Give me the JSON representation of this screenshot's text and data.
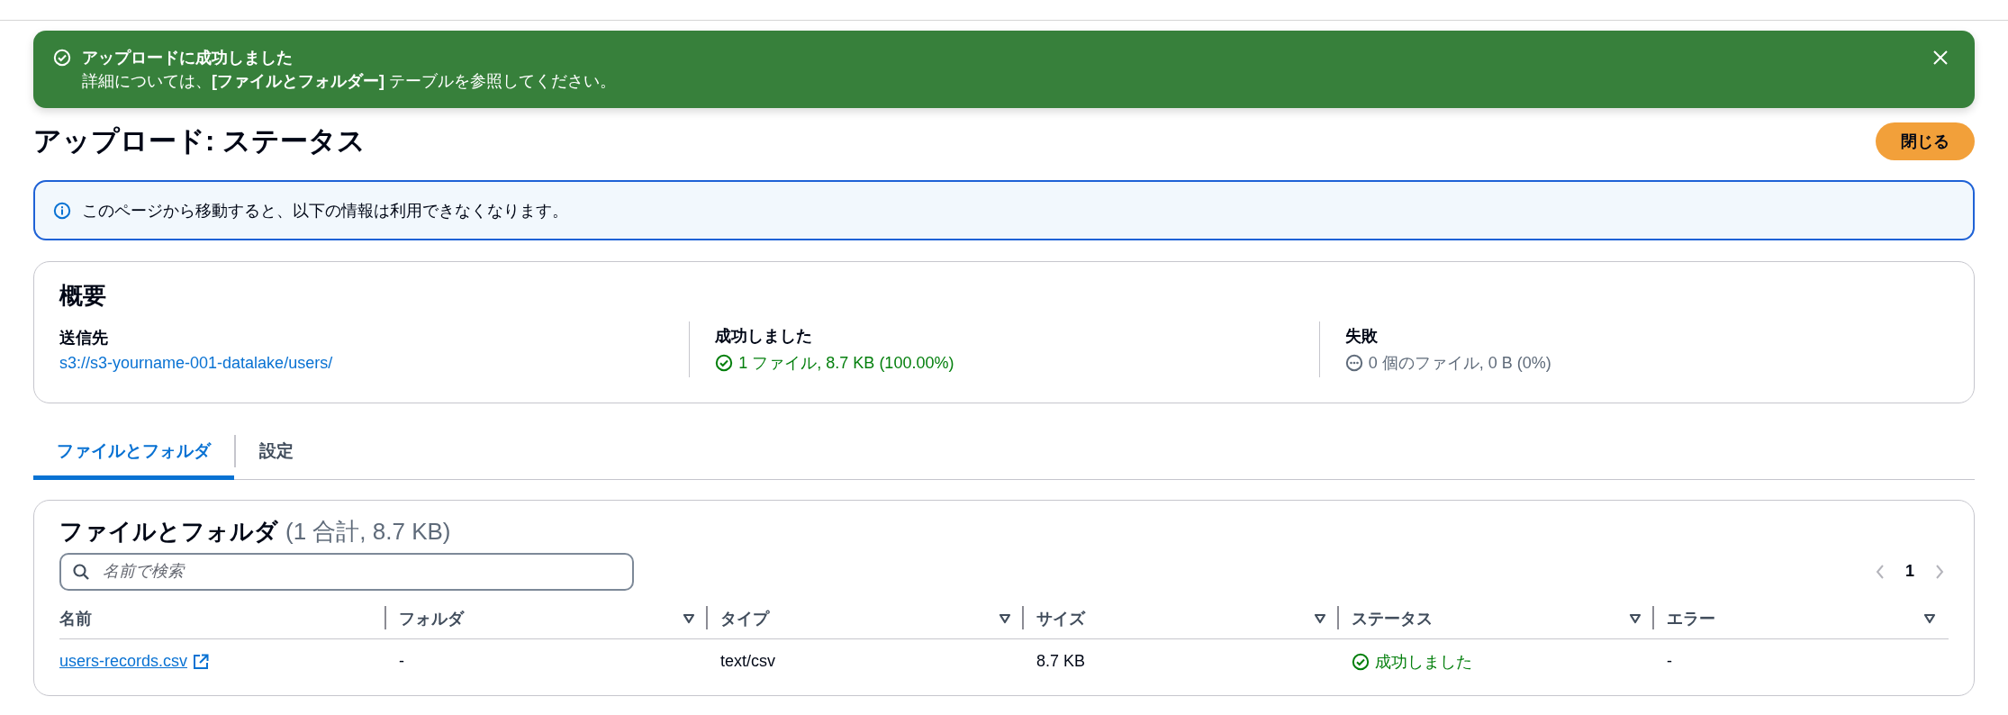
{
  "flash": {
    "title": "アップロードに成功しました",
    "message": "詳細については、**[ファイルとフォルダー]** テーブルを参照してください。",
    "dismissible": true
  },
  "header": {
    "title": "アップロード: ステータス",
    "button": "閉じる"
  },
  "info": {
    "message": "このページから移動すると、以下の情報は利用できなくなります。"
  },
  "summary": {
    "title": "概要",
    "items": [
      {
        "label": "送信先",
        "value": "s3://s3-yourname-001-datalake/users/",
        "kind": "link"
      },
      {
        "label": "成功しました",
        "value": "1 ファイル, 8.7 KB (100.00%)",
        "kind": "success"
      },
      {
        "label": "失敗",
        "value": "0 個のファイル, 0 B (0%)",
        "kind": "pending"
      }
    ]
  },
  "tabs": [
    {
      "label": "ファイルとフォルダ",
      "selected": true
    },
    {
      "label": "設定",
      "selected": false
    }
  ],
  "table": {
    "title": "ファイルとフォルダ",
    "count": "(1 合計, 8.7 KB)",
    "search": {
      "placeholder": "名前で検索"
    },
    "pagination": {
      "prev_disabled": true,
      "next_disabled": true,
      "pages": [
        {
          "label": "1",
          "selected": true
        }
      ]
    },
    "columns": [
      {
        "label": "名前",
        "filterable": false
      },
      {
        "label": "フォルダ",
        "filterable": true
      },
      {
        "label": "タイプ",
        "filterable": true
      },
      {
        "label": "サイズ",
        "filterable": true
      },
      {
        "label": "ステータス",
        "filterable": true
      },
      {
        "label": "エラー",
        "filterable": true
      }
    ],
    "rows": [
      {
        "cells": [
          {
            "text": "users-records.csv",
            "kind": "external-link"
          },
          {
            "text": "-",
            "kind": "text"
          },
          {
            "text": "text/csv",
            "kind": "text"
          },
          {
            "text": "8.7 KB",
            "kind": "text"
          },
          {
            "text": "成功しました",
            "kind": "success"
          },
          {
            "text": "-",
            "kind": "text"
          }
        ]
      }
    ]
  }
}
